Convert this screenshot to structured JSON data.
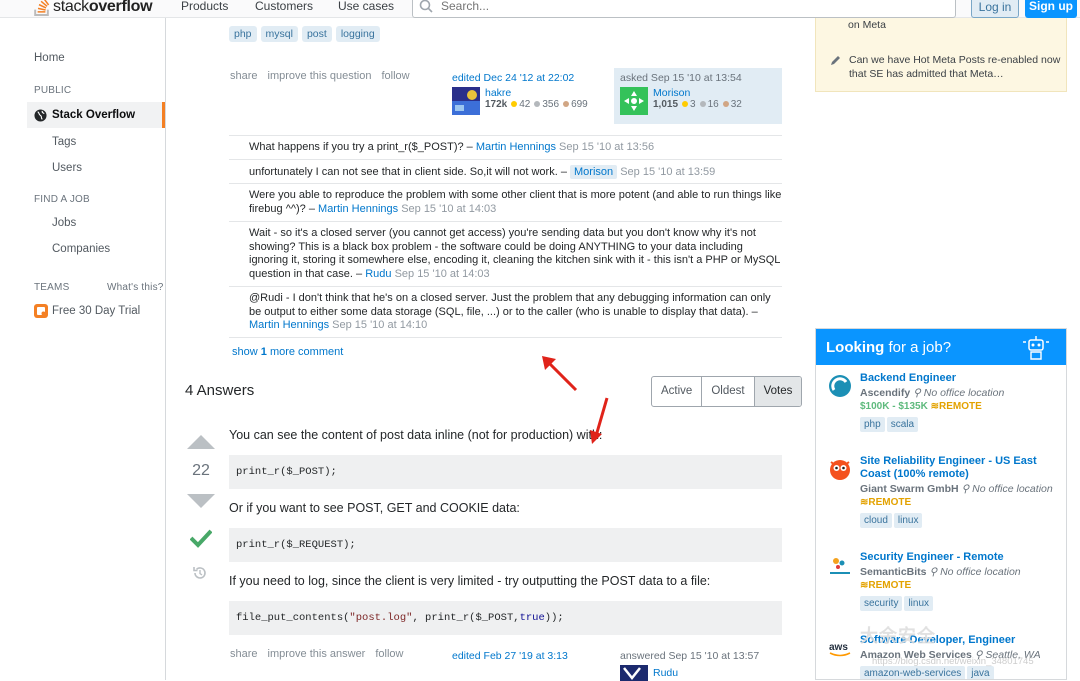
{
  "header": {
    "logo_word_a": "stack",
    "logo_word_b": "overflow",
    "nav": [
      "Products",
      "Customers",
      "Use cases"
    ],
    "search_placeholder": "Search...",
    "login": "Log in",
    "signup": "Sign up"
  },
  "sidebar": {
    "home": "Home",
    "public": "PUBLIC",
    "stackoverflow": "Stack Overflow",
    "tags": "Tags",
    "users": "Users",
    "find_job": "FIND A JOB",
    "jobs": "Jobs",
    "companies": "Companies",
    "teams": "TEAMS",
    "whats_this": "What's this?",
    "free_trial": "Free 30 Day Trial"
  },
  "question": {
    "tags": [
      "php",
      "mysql",
      "post",
      "logging"
    ],
    "menu": [
      "share",
      "improve this question",
      "follow"
    ],
    "edited": {
      "label": "edited Dec 24 '12 at 22:02",
      "user": "hakre",
      "rep": "172k",
      "gold": "42",
      "silver": "356",
      "bronze": "699"
    },
    "asked": {
      "label": "asked Sep 15 '10 at 13:54",
      "user": "Morison",
      "rep": "1,015",
      "gold": "3",
      "silver": "16",
      "bronze": "32"
    }
  },
  "comments": [
    {
      "text": "What happens if you try a print_r($_POST)? –",
      "user": "Martin Hennings",
      "date": "Sep 15 '10 at 13:56"
    },
    {
      "text": "unfortunately I can not see that in client side. So,it will not work. –",
      "user": "Morison",
      "date": "Sep 15 '10 at 13:59"
    },
    {
      "text": "Were you able to reproduce the problem with some other client that is more potent (and able to run things like firebug ^^)? –",
      "user": "Martin Hennings",
      "date": "Sep 15 '10 at 14:03"
    },
    {
      "text": "Wait - so it's a closed server (you cannot get access) you're sending data but you don't know why it's not showing? This is a black box problem - the software could be doing ANYTHING to your data including ignoring it, storing it somewhere else, encoding it, cleaning the kitchen sink with it - this isn't a PHP or MySQL question in that case. –",
      "user": "Rudu",
      "date": "Sep 15 '10 at 14:03"
    },
    {
      "text": "@Rudi - I don't think that he's on a closed server. Just the problem that any debugging information can only be output to either some data storage (SQL, file, ...) or to the caller (who is unable to display that data). –",
      "user": "Martin Hennings",
      "date": "Sep 15 '10 at 14:10"
    }
  ],
  "show_more": {
    "pre": "show",
    "num": "1",
    "post": "more comment"
  },
  "answers": {
    "count_label": "4 Answers",
    "sort": [
      "Active",
      "Oldest",
      "Votes"
    ],
    "score": "22",
    "p1": "You can see the content of post data inline (not for production) with:",
    "code1": "print_r($_POST);",
    "p2": "Or if you want to see POST, GET and COOKIE data:",
    "code2": "print_r($_REQUEST);",
    "p3": "If you need to log, since the client is very limited - try outputting the POST data to a file:",
    "code3_a": "file_put_contents(",
    "code3_str": "\"post.log\"",
    "code3_b": ", print_r($_POST, ",
    "code3_kw": "true",
    "code3_c": "));",
    "menu": [
      "share",
      "improve this answer",
      "follow"
    ],
    "edited": "edited Feb 27 '19 at 3:13",
    "answered": "answered Sep 15 '10 at 13:57",
    "answer_user": "Rudu"
  },
  "meta": {
    "item1": "on Meta",
    "item2": "Can we have Hot Meta Posts re-enabled now that SE has admitted that Meta…"
  },
  "jobs": {
    "heading_a": "Looking",
    "heading_b": "for a job?",
    "list": [
      {
        "title": "Backend Engineer",
        "company": "Ascendify",
        "loc": "No office location",
        "salary": "$100K - $135K",
        "remote": "REMOTE",
        "tags": [
          "php",
          "scala"
        ]
      },
      {
        "title": "Site Reliability Engineer - US East Coast (100% remote)",
        "company": "Giant Swarm GmbH",
        "loc": "No office location",
        "remote": "REMOTE",
        "tags": [
          "cloud",
          "linux"
        ]
      },
      {
        "title": "Security Engineer - Remote",
        "company": "SemanticBits",
        "loc": "No office location",
        "remote": "REMOTE",
        "tags": [
          "security",
          "linux"
        ]
      },
      {
        "title": "Software Developer, Engineer",
        "company": "Amazon Web Services",
        "loc": "Seattle, WA",
        "tags": [
          "amazon-web-services",
          "java"
        ]
      }
    ]
  },
  "watermark": "大余安全",
  "watermark_url": "https://blog.csdn.net/weixin_34801745",
  "colors": {
    "accent": "#f48024",
    "link": "#0077cc",
    "jobs_header": "#0a95ff",
    "accepted": "#48a868",
    "arrow": "#e0231a"
  }
}
